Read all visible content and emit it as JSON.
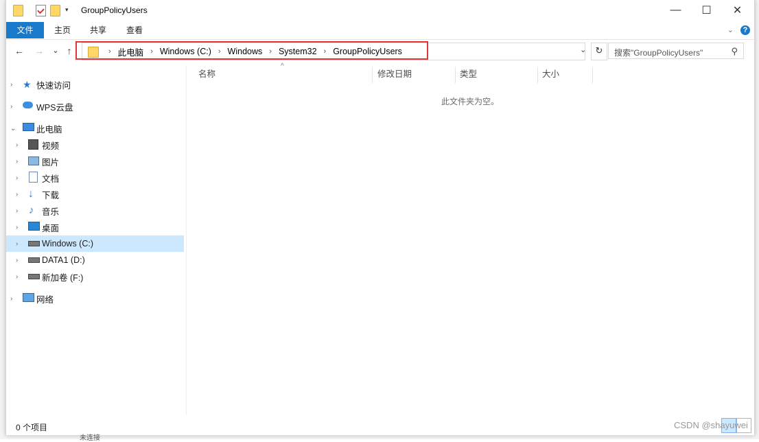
{
  "window": {
    "title": "GroupPolicyUsers",
    "controls": {
      "minimize": "—",
      "maximize": "☐",
      "close": "✕"
    }
  },
  "ribbon": {
    "tabs": [
      "文件",
      "主页",
      "共享",
      "查看"
    ],
    "help": "?"
  },
  "navigation": {
    "back": "←",
    "forward": "→",
    "recent": "⌄",
    "up": "↑",
    "breadcrumb": [
      "此电脑",
      "Windows (C:)",
      "Windows",
      "System32",
      "GroupPolicyUsers"
    ],
    "refresh": "↻",
    "search_placeholder": "搜索\"GroupPolicyUsers\""
  },
  "sidebar": {
    "items": [
      {
        "label": "快速访问",
        "icon": "star-icon"
      },
      {
        "label": "WPS云盘",
        "icon": "cloud-icon"
      },
      {
        "label": "此电脑",
        "icon": "computer-icon"
      },
      {
        "label": "视频",
        "icon": "video-icon"
      },
      {
        "label": "图片",
        "icon": "picture-icon"
      },
      {
        "label": "文档",
        "icon": "document-icon"
      },
      {
        "label": "下载",
        "icon": "download-icon"
      },
      {
        "label": "音乐",
        "icon": "music-icon"
      },
      {
        "label": "桌面",
        "icon": "desktop-icon"
      },
      {
        "label": "Windows (C:)",
        "icon": "drive-icon",
        "selected": true
      },
      {
        "label": "DATA1 (D:)",
        "icon": "drive-icon"
      },
      {
        "label": "新加卷 (F:)",
        "icon": "drive-icon"
      },
      {
        "label": "网络",
        "icon": "network-icon"
      }
    ]
  },
  "content": {
    "columns": [
      "名称",
      "修改日期",
      "类型",
      "大小"
    ],
    "empty_message": "此文件夹为空。"
  },
  "status": {
    "count": "0 个项目"
  },
  "colors": {
    "accent": "#1979ca",
    "selection": "#cce8ff",
    "highlight_box": "#e23535"
  },
  "watermark": "CSDN @shayuwei",
  "background_fragment": "未连接"
}
